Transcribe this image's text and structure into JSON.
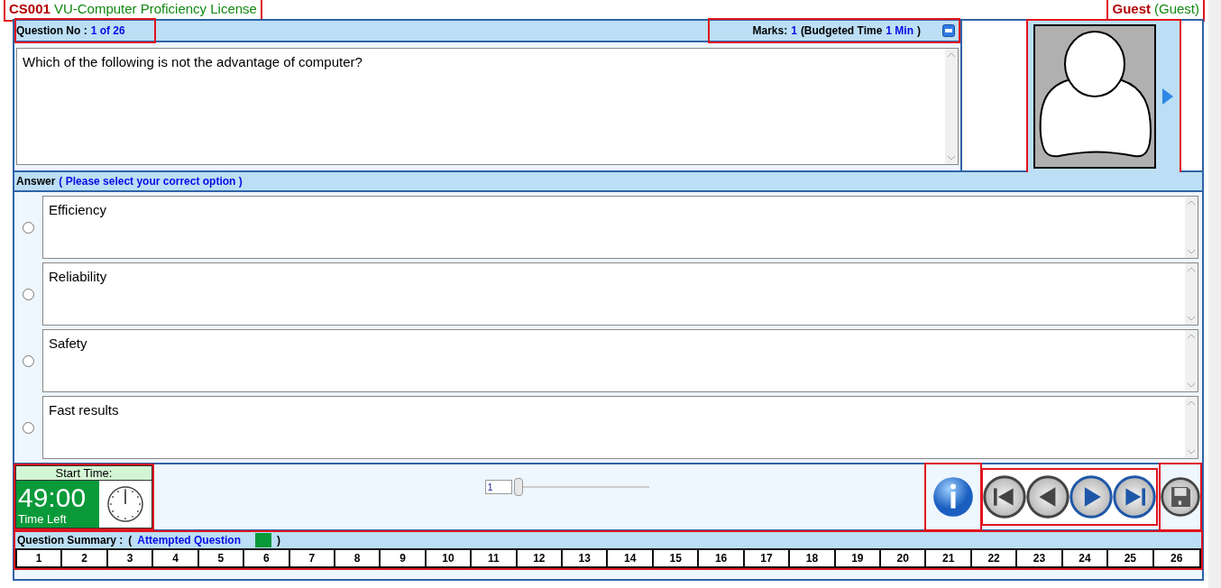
{
  "header": {
    "code": "CS001",
    "course": "VU-Computer Proficiency License",
    "user": "Guest",
    "role": "(Guest)"
  },
  "question": {
    "label": "Question No :",
    "number": "1 of 26",
    "marks_label": "Marks:",
    "marks": "1",
    "time_open": "(Budgeted Time",
    "time": "1 Min",
    "time_close": ")",
    "text": "Which of the following is not the advantage of computer?"
  },
  "answer": {
    "label": "Answer",
    "hint": "( Please select your correct option )"
  },
  "options": [
    {
      "text": "Efficiency",
      "selected": false
    },
    {
      "text": "Reliability",
      "selected": false
    },
    {
      "text": "Safety",
      "selected": false
    },
    {
      "text": "Fast results",
      "selected": false
    }
  ],
  "timer": {
    "start_label": "Start Time:",
    "time": "49:00",
    "caption": "Time Left"
  },
  "jump": {
    "value": "1",
    "level": 0
  },
  "nav": [
    {
      "kind": "first",
      "disabled": true
    },
    {
      "kind": "previous",
      "disabled": true
    },
    {
      "kind": "next",
      "disabled": false
    },
    {
      "kind": "last",
      "disabled": false
    }
  ],
  "summary": {
    "label": "Question Summary :",
    "open": "(",
    "legend": {
      "text": "Attempted Question",
      "color": "#0a9a3a"
    },
    "close": ")",
    "cells": [
      {
        "n": "1",
        "attempted": false
      },
      {
        "n": "2",
        "attempted": false
      },
      {
        "n": "3",
        "attempted": false
      },
      {
        "n": "4",
        "attempted": false
      },
      {
        "n": "5",
        "attempted": false
      },
      {
        "n": "6",
        "attempted": false
      },
      {
        "n": "7",
        "attempted": false
      },
      {
        "n": "8",
        "attempted": false
      },
      {
        "n": "9",
        "attempted": false
      },
      {
        "n": "10",
        "attempted": false
      },
      {
        "n": "11",
        "attempted": false
      },
      {
        "n": "12",
        "attempted": false
      },
      {
        "n": "13",
        "attempted": false
      },
      {
        "n": "14",
        "attempted": false
      },
      {
        "n": "15",
        "attempted": false
      },
      {
        "n": "16",
        "attempted": false
      },
      {
        "n": "17",
        "attempted": false
      },
      {
        "n": "18",
        "attempted": false
      },
      {
        "n": "19",
        "attempted": false
      },
      {
        "n": "20",
        "attempted": false
      },
      {
        "n": "21",
        "attempted": false
      },
      {
        "n": "22",
        "attempted": false
      },
      {
        "n": "23",
        "attempted": false
      },
      {
        "n": "24",
        "attempted": false
      },
      {
        "n": "25",
        "attempted": false
      },
      {
        "n": "26",
        "attempted": false
      }
    ]
  }
}
